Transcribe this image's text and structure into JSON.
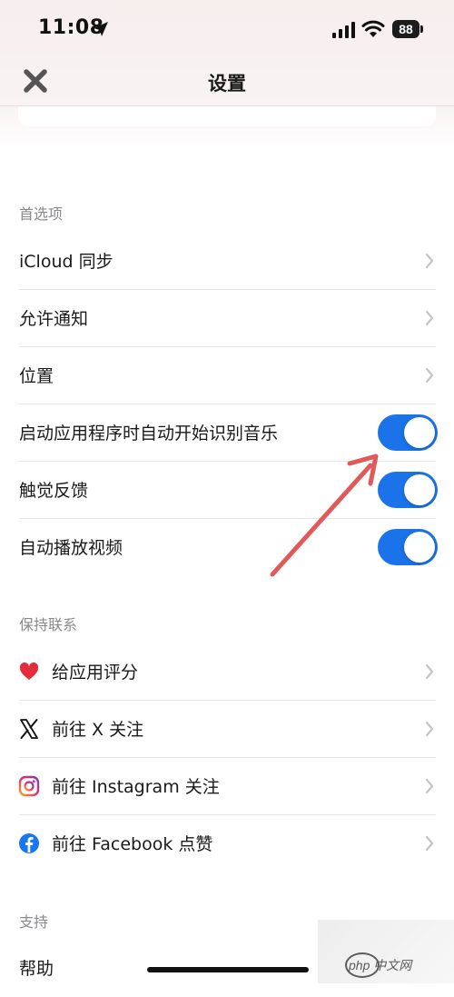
{
  "status_bar": {
    "time": "11:08",
    "battery": "88"
  },
  "nav": {
    "title": "设置"
  },
  "sections": [
    {
      "header": "首选项",
      "rows": [
        {
          "label": "iCloud 同步",
          "type": "chevron"
        },
        {
          "label": "允许通知",
          "type": "chevron"
        },
        {
          "label": "位置",
          "type": "chevron"
        },
        {
          "label": "启动应用程序时自动开始识别音乐",
          "type": "toggle",
          "on": true
        },
        {
          "label": "触觉反馈",
          "type": "toggle",
          "on": true
        },
        {
          "label": "自动播放视频",
          "type": "toggle",
          "on": true
        }
      ]
    },
    {
      "header": "保持联系",
      "rows": [
        {
          "label": "给应用评分",
          "icon": "heart-icon",
          "type": "chevron"
        },
        {
          "label": "前往 X 关注",
          "icon": "x-logo-icon",
          "type": "chevron"
        },
        {
          "label": "前往 Instagram 关注",
          "icon": "instagram-icon",
          "type": "chevron"
        },
        {
          "label": "前往 Facebook 点赞",
          "icon": "facebook-icon",
          "type": "chevron"
        }
      ]
    },
    {
      "header": "支持",
      "rows": [
        {
          "label": "帮助",
          "type": "chevron"
        }
      ]
    }
  ],
  "watermark": {
    "text": "php 中文网"
  },
  "colors": {
    "toggle_on": "#1a73e8",
    "annotation_arrow": "#e05a5a"
  }
}
